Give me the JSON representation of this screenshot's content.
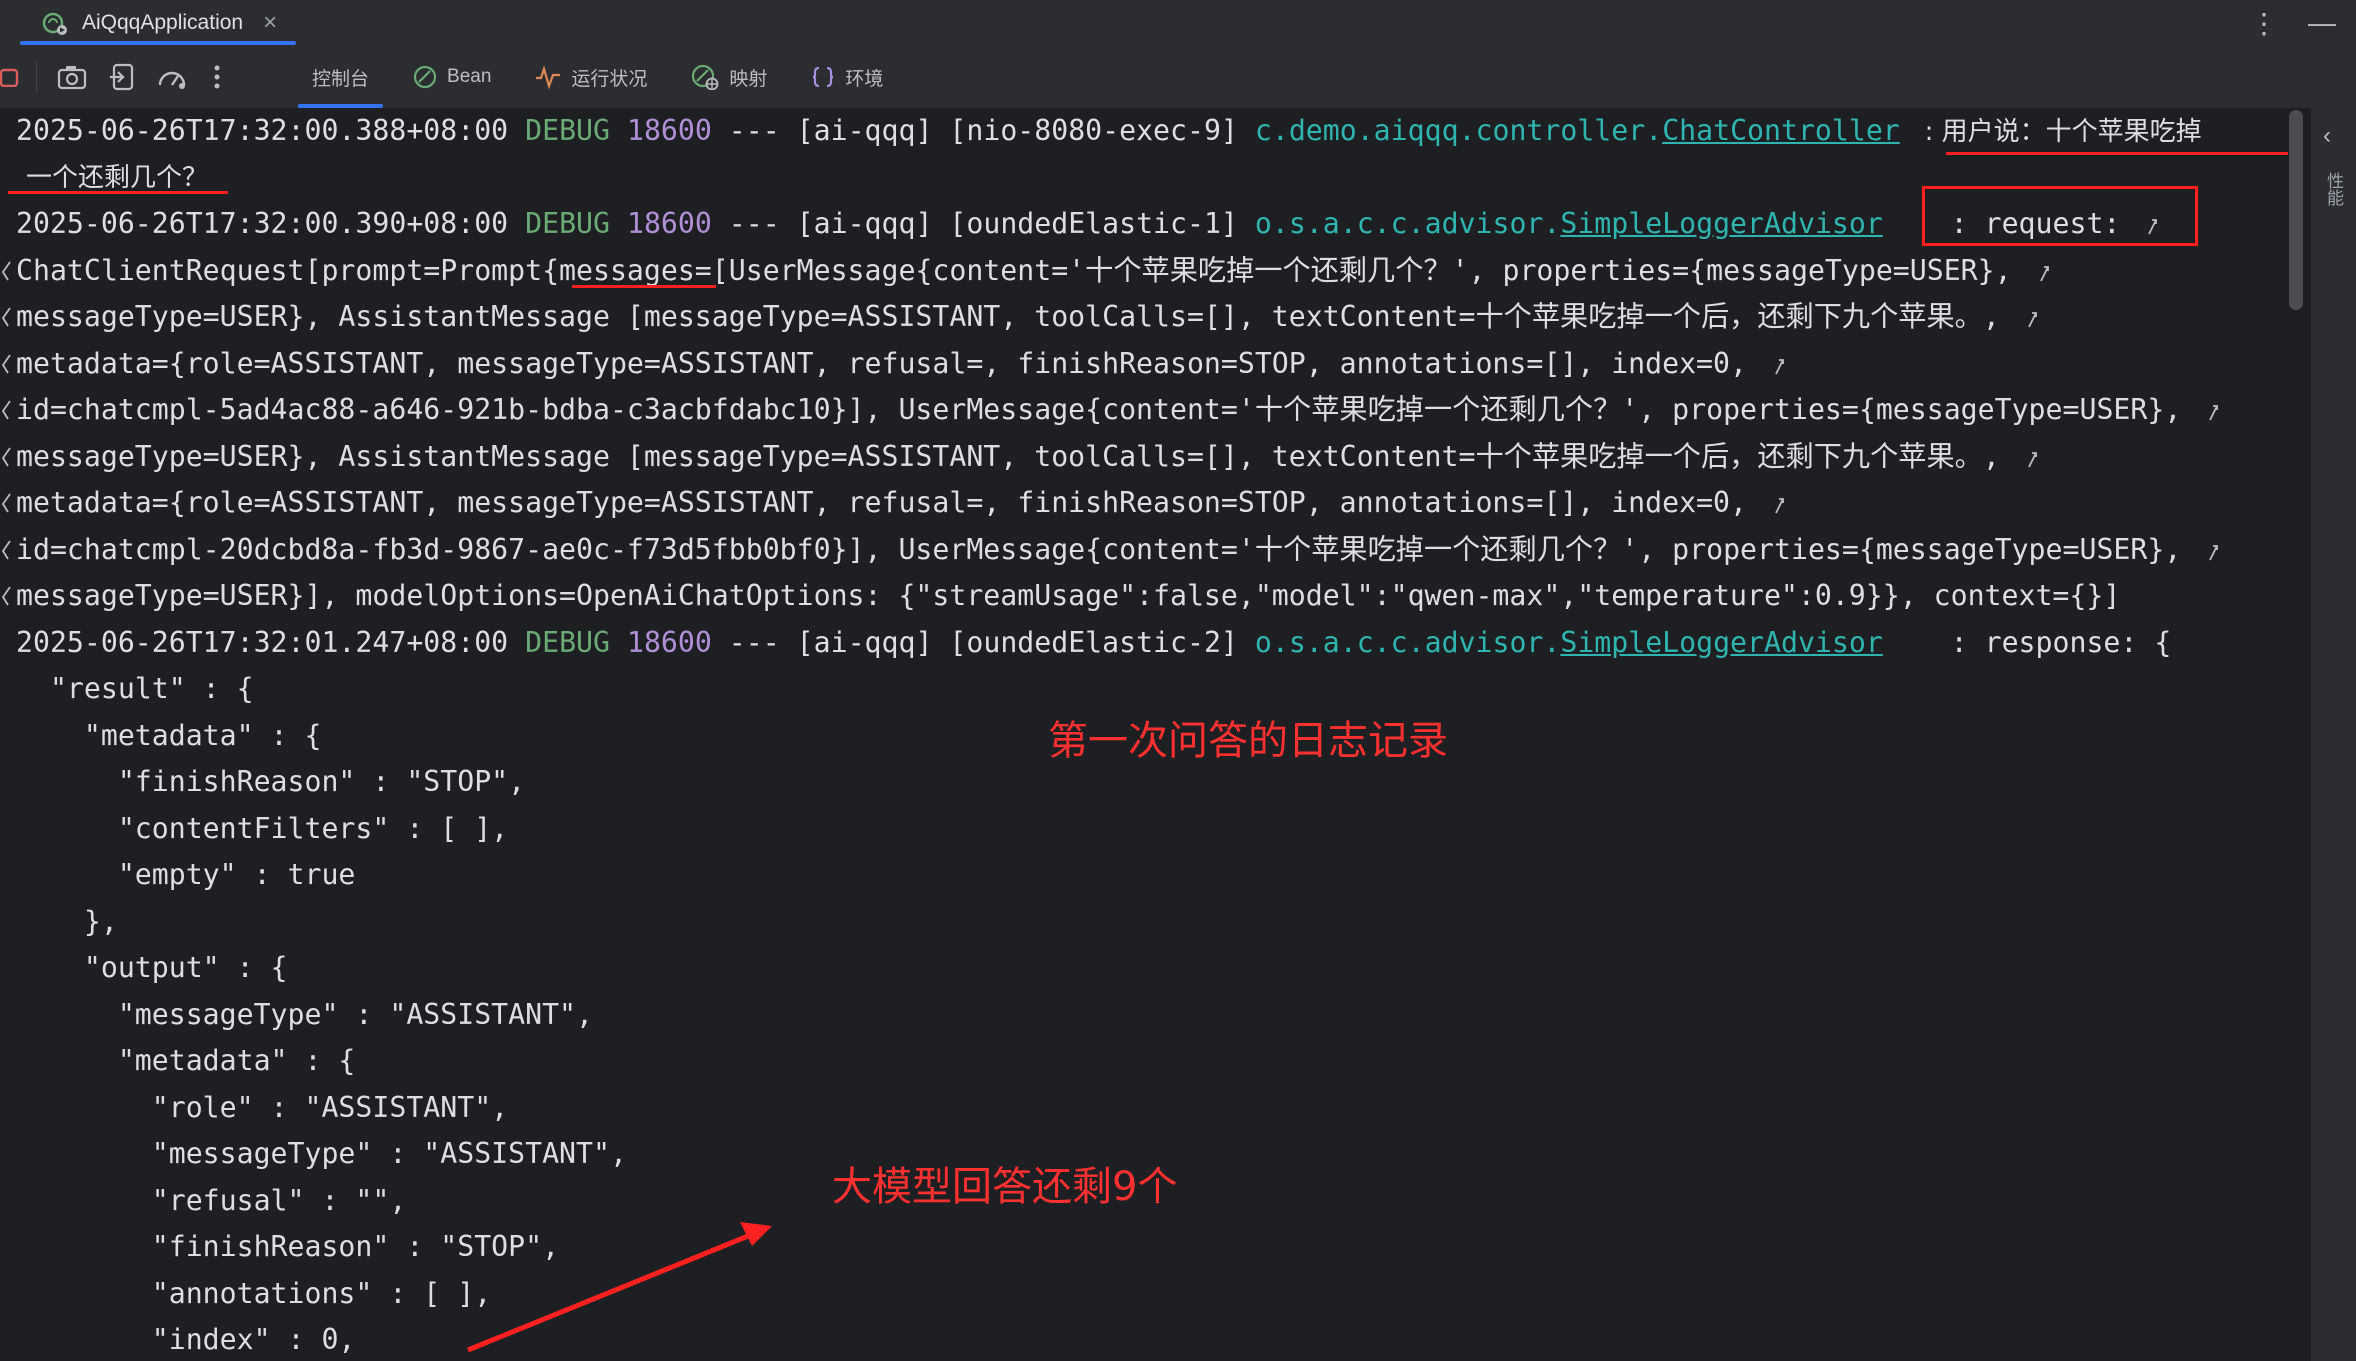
{
  "tab": {
    "title": "AiQqqApplication",
    "close": "×"
  },
  "title_actions": {
    "more": "⋮",
    "minimize": "—"
  },
  "toolbar": {
    "icons": [
      "stop-icon",
      "camera-icon",
      "restore-layout-icon",
      "performance-icon",
      "more-icon"
    ],
    "view_tabs": [
      {
        "label": "控制台",
        "icon": ""
      },
      {
        "label": "Bean",
        "icon": "bean-icon"
      },
      {
        "label": "运行状况",
        "icon": "health-icon"
      },
      {
        "label": "映射",
        "icon": "mapping-icon"
      },
      {
        "label": "环境",
        "icon": "environment-icon"
      }
    ]
  },
  "side_panel": {
    "collapse": "‹",
    "label": "性能"
  },
  "log": {
    "line1": {
      "ts": "2025-06-26T17:32:00.388+08:00",
      "level": "DEBUG",
      "pid": "18600",
      "mid": " --- [ai-qqq] [nio-8080-exec-9] ",
      "pkg": "c.demo.aiqqq.controller.",
      "cls": "ChatController",
      "msg": "   : 用户说：十个苹果吃掉",
      "cont": "一个还剩几个？"
    },
    "line2": {
      "ts": "2025-06-26T17:32:00.390+08:00",
      "level": "DEBUG",
      "pid": "18600",
      "mid": " --- [ai-qqq] [oundedElastic-1] ",
      "pkg": "o.s.a.c.c.advisor.",
      "cls": "SimpleLoggerAdvisor",
      "msg": "    : request: "
    },
    "request_lines": [
      "ChatClientRequest[prompt=Prompt{messages=[UserMessage{content='十个苹果吃掉一个还剩几个？', properties={messageType=USER}, ",
      "messageType=USER}, AssistantMessage [messageType=ASSISTANT, toolCalls=[], textContent=十个苹果吃掉一个后，还剩下九个苹果。, ",
      "metadata={role=ASSISTANT, messageType=ASSISTANT, refusal=, finishReason=STOP, annotations=[], index=0, ",
      "id=chatcmpl-5ad4ac88-a646-921b-bdba-c3acbfdabc10}], UserMessage{content='十个苹果吃掉一个还剩几个？', properties={messageType=USER}, ",
      "messageType=USER}, AssistantMessage [messageType=ASSISTANT, toolCalls=[], textContent=十个苹果吃掉一个后，还剩下九个苹果。, ",
      "metadata={role=ASSISTANT, messageType=ASSISTANT, refusal=, finishReason=STOP, annotations=[], index=0, ",
      "id=chatcmpl-20dcbd8a-fb3d-9867-ae0c-f73d5fbb0bf0}], UserMessage{content='十个苹果吃掉一个还剩几个？', properties={messageType=USER}, ",
      "messageType=USER}], modelOptions=OpenAiChatOptions: {\"streamUsage\":false,\"model\":\"qwen-max\",\"temperature\":0.9}}, context={}]"
    ],
    "line3": {
      "ts": "2025-06-26T17:32:01.247+08:00",
      "level": "DEBUG",
      "pid": "18600",
      "mid": " --- [ai-qqq] [oundedElastic-2] ",
      "pkg": "o.s.a.c.c.advisor.",
      "cls": "SimpleLoggerAdvisor",
      "msg": "    : response: {"
    },
    "json_lines": [
      "  \"result\" : {",
      "    \"metadata\" : {",
      "      \"finishReason\" : \"STOP\",",
      "      \"contentFilters\" : [ ],",
      "      \"empty\" : true",
      "    },",
      "    \"output\" : {",
      "      \"messageType\" : \"ASSISTANT\",",
      "      \"metadata\" : {",
      "        \"role\" : \"ASSISTANT\",",
      "        \"messageType\" : \"ASSISTANT\",",
      "        \"refusal\" : \"\",",
      "        \"finishReason\" : \"STOP\",",
      "        \"annotations\" : [ ],",
      "        \"index\" : 0,"
    ]
  },
  "annotations": {
    "first_qa": "第一次问答的日志记录",
    "model_answer": "大模型回答还剩9个",
    "color": "#ff2020"
  },
  "colors": {
    "background": "#1e1f22",
    "toolbar": "#2b2d30",
    "accent": "#3574f0",
    "level": "#6aab73",
    "pid": "#b08fd6",
    "logger": "#2fb5b0"
  }
}
